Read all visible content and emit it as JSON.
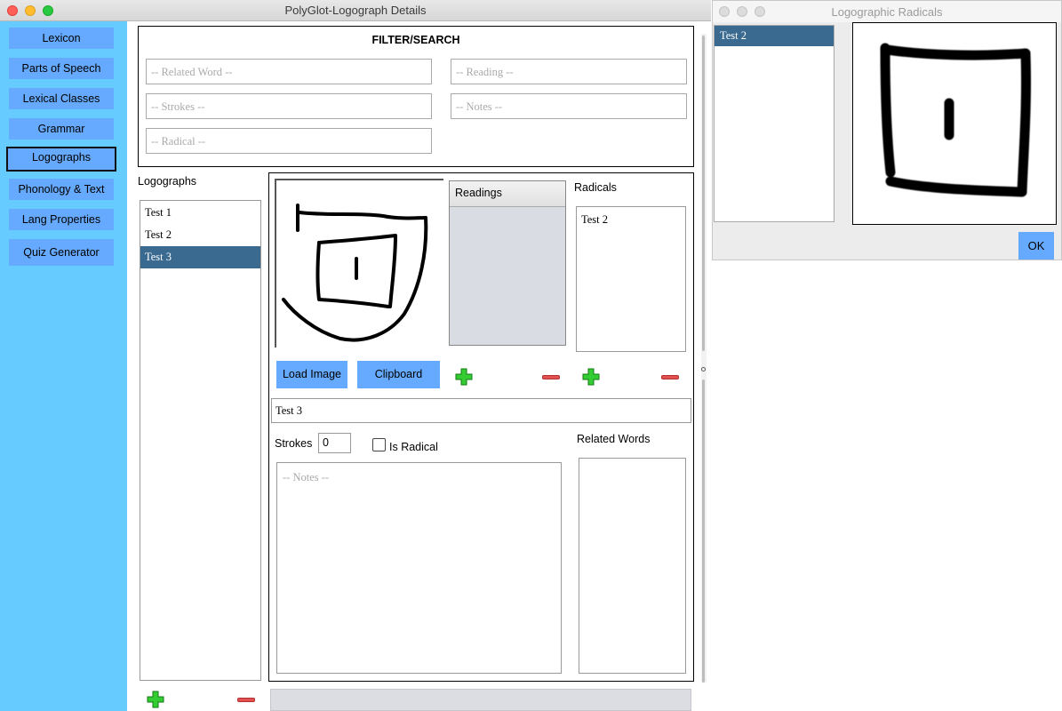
{
  "main_window": {
    "title": "PolyGlot-Logograph Details",
    "sidebar": [
      {
        "label": "Lexicon"
      },
      {
        "label": "Parts of Speech"
      },
      {
        "label": "Lexical Classes"
      },
      {
        "label": "Grammar"
      },
      {
        "label": "Logographs",
        "active": true
      },
      {
        "label": "Phonology & Text"
      },
      {
        "label": "Lang Properties"
      },
      {
        "label": "Quiz Generator"
      }
    ],
    "filter": {
      "title": "FILTER/SEARCH",
      "related_word_placeholder": "-- Related Word --",
      "reading_placeholder": "-- Reading --",
      "strokes_placeholder": "-- Strokes --",
      "notes_placeholder": "-- Notes --",
      "radical_placeholder": "-- Radical --"
    },
    "logographs": {
      "label": "Logographs",
      "items": [
        "Test 1",
        "Test 2",
        "Test 3"
      ],
      "selected": "Test 3"
    },
    "detail": {
      "readings_header": "Readings",
      "radicals_label": "Radicals",
      "radicals_items": [
        "Test 2"
      ],
      "load_image_label": "Load Image",
      "clipboard_label": "Clipboard",
      "name_value": "Test 3",
      "strokes_label": "Strokes",
      "strokes_value": "0",
      "is_radical_label": "Is Radical",
      "is_radical_checked": false,
      "notes_placeholder": "-- Notes --",
      "related_words_label": "Related Words"
    }
  },
  "radicals_window": {
    "title": "Logographic Radicals",
    "items": [
      "Test 2"
    ],
    "ok_label": "OK"
  },
  "colors": {
    "sidebar_bg": "#66ccff",
    "button_bg": "#66aaff",
    "selection_bg": "#3b6a91",
    "plus_green": "#33cc33",
    "minus_red": "#e35050"
  },
  "icons": [
    "plus-icon",
    "minus-icon",
    "close-light-icon",
    "minimize-light-icon",
    "zoom-light-icon"
  ]
}
